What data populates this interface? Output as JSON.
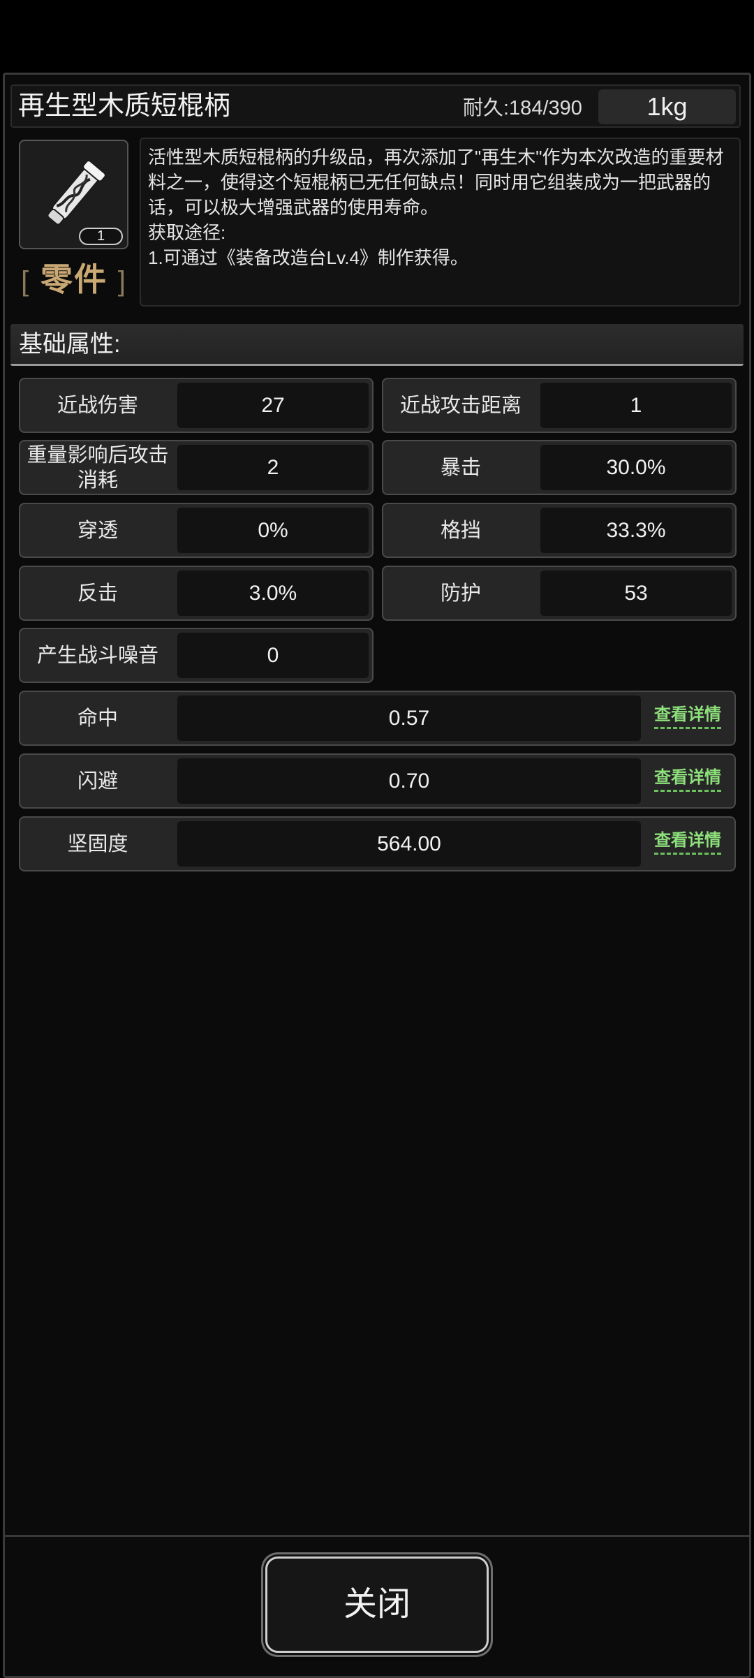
{
  "item": {
    "name": "再生型木质短棍柄",
    "durability": "耐久:184/390",
    "weight": "1kg",
    "count": "1",
    "category": "零件",
    "category_left_bracket": "[",
    "category_right_bracket": "]",
    "icon": "wooden-handle-icon",
    "description": "活性型木质短棍柄的升级品，再次添加了\"再生木\"作为本次改造的重要材料之一，使得这个短棍柄已无任何缺点！同时用它组装成为一把武器的话，可以极大增强武器的使用寿命。\n获取途径:\n1.可通过《装备改造台Lv.4》制作获得。"
  },
  "section": {
    "title": "基础属性:"
  },
  "stats": [
    {
      "label": "近战伤害",
      "value": "27"
    },
    {
      "label": "近战攻击距离",
      "value": "1"
    },
    {
      "label": "重量影响后攻击消耗",
      "value": "2"
    },
    {
      "label": "暴击",
      "value": "30.0%"
    },
    {
      "label": "穿透",
      "value": "0%"
    },
    {
      "label": "格挡",
      "value": "33.3%"
    },
    {
      "label": "反击",
      "value": "3.0%"
    },
    {
      "label": "防护",
      "value": "53"
    },
    {
      "label": "产生战斗噪音",
      "value": "0"
    }
  ],
  "detail_stats": [
    {
      "label": "命中",
      "value": "0.57",
      "link": "查看详情"
    },
    {
      "label": "闪避",
      "value": "0.70",
      "link": "查看详情"
    },
    {
      "label": "坚固度",
      "value": "564.00",
      "link": "查看详情"
    }
  ],
  "footer": {
    "close_label": "关闭"
  },
  "colors": {
    "accent_gold": "#c9a874",
    "link_green": "#8de07b"
  }
}
